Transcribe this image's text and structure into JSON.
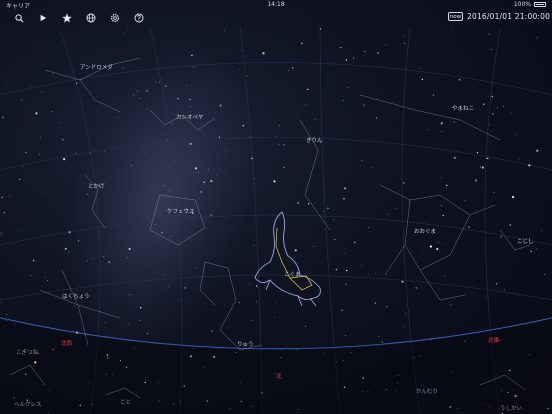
{
  "status_bar": {
    "carrier": "キャリア",
    "time": "14:18",
    "battery": "100%"
  },
  "toolbar": {
    "buttons": [
      {
        "icon": "search-icon"
      },
      {
        "icon": "play-icon"
      },
      {
        "icon": "star-icon"
      },
      {
        "icon": "globe-icon"
      },
      {
        "icon": "gear-icon"
      },
      {
        "icon": "help-icon"
      }
    ],
    "now_label": "now",
    "datetime": "2016/01/01 21:00:00"
  },
  "constellations": {
    "andromeda": "アンドロメダ",
    "cassiopeia": "カシオペヤ",
    "giraffe": "きりん",
    "lynx": "やまねこ",
    "lizard": "とかげ",
    "cepheus": "ケフェウス",
    "ursa_major": "おおぐま",
    "leo_minor": "こじし",
    "ursa_minor": "こぐま",
    "cygnus": "はくちょう",
    "draco": "りゅう",
    "lyra": "こと",
    "hercules": "ヘルクレス",
    "bootes": "うしかい",
    "corona": "かんむり",
    "vulpecula": "こぎつね"
  },
  "directions": {
    "northwest": "北西",
    "north": "北",
    "northeast": "北東"
  },
  "colors": {
    "horizon": "#3a6fd0",
    "direction_label": "#ff3b2f",
    "constellation_line": "#9aa3c4"
  }
}
